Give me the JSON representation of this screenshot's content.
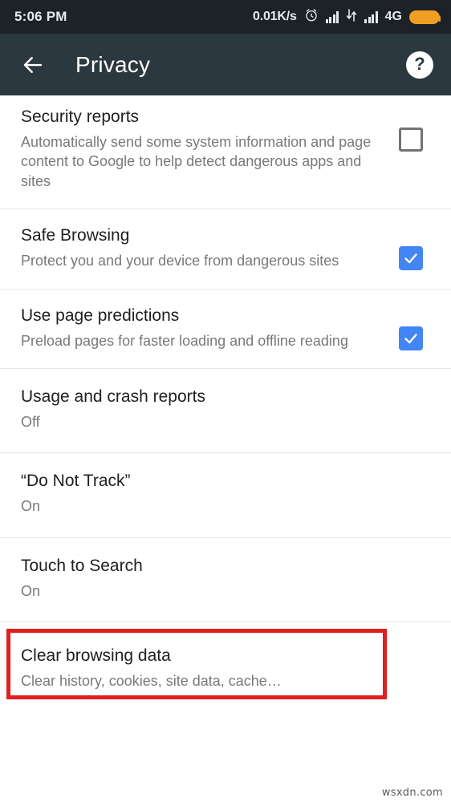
{
  "status_bar": {
    "time": "5:06 PM",
    "net_speed": "0.01K/s",
    "network_type": "4G",
    "icons": [
      "alarm-icon",
      "signal-icon",
      "data-transfer-icon",
      "signal-icon",
      "battery-icon"
    ],
    "background_color": "#1c2227"
  },
  "toolbar": {
    "back_label": "back-arrow",
    "title": "Privacy",
    "help_label": "?",
    "background_color": "#2c383f"
  },
  "settings": [
    {
      "title": "Security reports",
      "subtitle": "Automatically send some system information and page content to Google to help detect dangerous apps and sites",
      "control": "checkbox",
      "checked": false
    },
    {
      "title": "Safe Browsing",
      "subtitle": "Protect you and your device from dangerous sites",
      "control": "checkbox",
      "checked": true
    },
    {
      "title": "Use page predictions",
      "subtitle": "Preload pages for faster loading and offline reading",
      "control": "checkbox",
      "checked": true
    },
    {
      "title": "Usage and crash reports",
      "subtitle": "Off",
      "control": "none",
      "checked": false
    },
    {
      "title": "“Do Not Track”",
      "subtitle": "On",
      "control": "none",
      "checked": false
    },
    {
      "title": "Touch to Search",
      "subtitle": "On",
      "control": "none",
      "checked": false
    },
    {
      "title": "Clear browsing data",
      "subtitle": "Clear history, cookies, site data, cache…",
      "control": "none",
      "checked": false,
      "highlighted": true
    }
  ],
  "highlight": {
    "color": "#e01f1f"
  },
  "watermark": "wsxdn.com",
  "accent_color": "#4285f4"
}
